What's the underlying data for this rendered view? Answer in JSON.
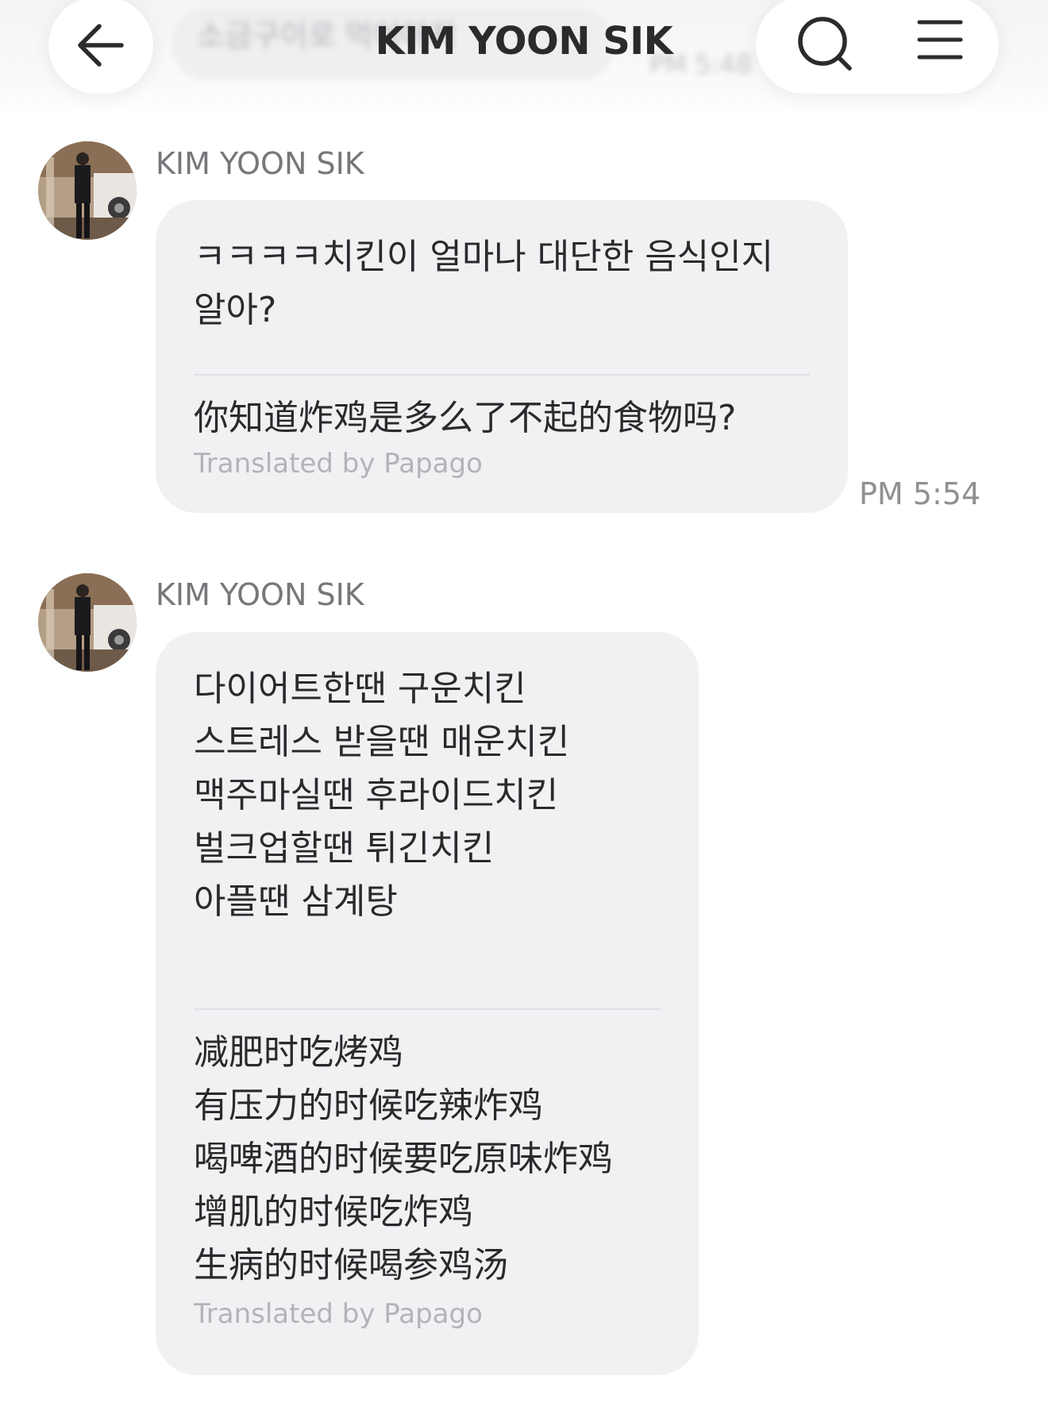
{
  "header": {
    "title": "KIM YOON SIK",
    "back_icon": "arrow-left-icon",
    "search_icon": "search-icon",
    "menu_icon": "hamburger-menu-icon",
    "preview_text": "소금구이로 먹어야지",
    "preview_time": "PM 5:48"
  },
  "messages": [
    {
      "sender": "KIM YOON SIK",
      "original": "ㅋㅋㅋㅋ치킨이 얼마나 대단한 음식인지\n알아?",
      "translation": "你知道炸鸡是多么了不起的食物吗?",
      "translated_by": "Translated by Papago",
      "time": "PM 5:54"
    },
    {
      "sender": "KIM YOON SIK",
      "original": "다이어트한땐 구운치킨\n스트레스 받을땐 매운치킨\n맥주마실땐 후라이드치킨\n벌크업할땐 튀긴치킨\n아플땐 삼계탕",
      "translation": "减肥时吃烤鸡\n有压力的时候吃辣炸鸡\n喝啤酒的时候要吃原味炸鸡\n增肌的时候吃炸鸡\n生病的时候喝参鸡汤",
      "translated_by": "Translated by Papago"
    }
  ],
  "colors": {
    "bubble": "#f1f1f4",
    "text": "#2a2a2d",
    "secondary": "#77777b",
    "muted": "#b4b4b8"
  }
}
